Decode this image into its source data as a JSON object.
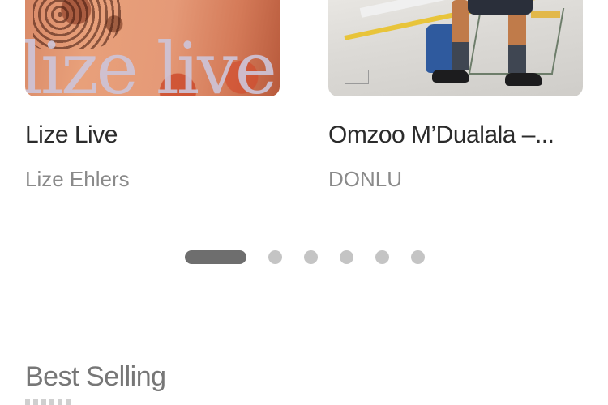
{
  "carousel": {
    "items": [
      {
        "title": "Lize Live",
        "artist": "Lize Ehlers",
        "cover_text": "lize live",
        "cover_colors": [
          "#e59a78",
          "#b85a3c",
          "#cdc3d7"
        ]
      },
      {
        "title": "Omzoo M’Dualala –...",
        "artist": "DONLU",
        "cover_colors": [
          "#dcdad6",
          "#e8c43a",
          "#2f5a9e"
        ]
      }
    ],
    "pager": {
      "total": 6,
      "active": 1,
      "active_color": "#6e6e6e",
      "inactive_color": "#c4c4c4"
    }
  },
  "sections": {
    "best_selling": {
      "title": "Best Selling"
    }
  }
}
